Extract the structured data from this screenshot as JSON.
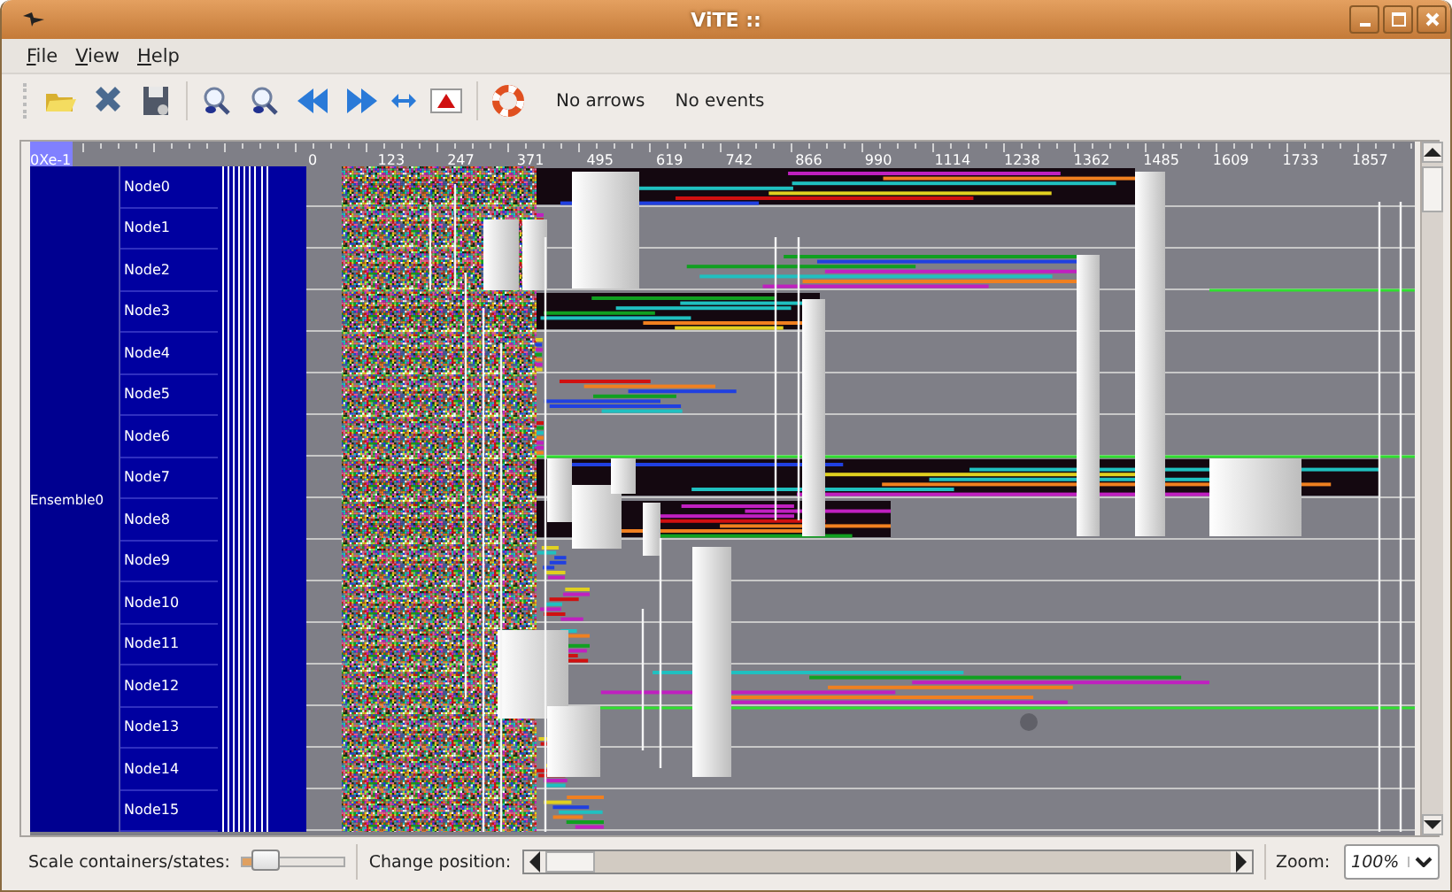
{
  "window": {
    "title": "ViTE ::"
  },
  "menu": [
    {
      "label": "File"
    },
    {
      "label": "View"
    },
    {
      "label": "Help"
    }
  ],
  "toolbar": {
    "arrows_label": "No arrows",
    "events_label": "No events"
  },
  "ruler": {
    "origin_label": "0Xe-1",
    "ticks": [
      "0",
      "123",
      "247",
      "371",
      "495",
      "619",
      "742",
      "866",
      "990",
      "1114",
      "1238",
      "1362",
      "1485",
      "1609",
      "1733",
      "1857"
    ]
  },
  "container": {
    "label": "Ensemble0",
    "children": [
      {
        "label": "Node0"
      },
      {
        "label": "Node1"
      },
      {
        "label": "Node2"
      },
      {
        "label": "Node3"
      },
      {
        "label": "Node4"
      },
      {
        "label": "Node5"
      },
      {
        "label": "Node6"
      },
      {
        "label": "Node7"
      },
      {
        "label": "Node8"
      },
      {
        "label": "Node9"
      },
      {
        "label": "Node10"
      },
      {
        "label": "Node11"
      },
      {
        "label": "Node12"
      },
      {
        "label": "Node13"
      },
      {
        "label": "Node14"
      },
      {
        "label": "Node15"
      }
    ]
  },
  "bottom_bar": {
    "scale_label": "Scale containers/states:",
    "scale_slider": {
      "level": 0.2
    },
    "position_label": "Change position:",
    "zoom_label": "Zoom:",
    "zoom_value": "100%"
  }
}
